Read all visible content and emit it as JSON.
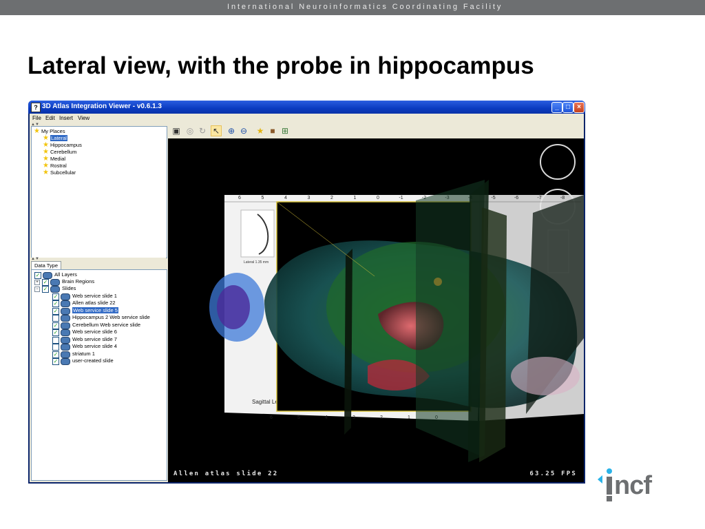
{
  "header": {
    "organization": "International Neuroinformatics Coordinating Facility"
  },
  "slide": {
    "title": "Lateral view, with the probe in hippocampus"
  },
  "window": {
    "app_icon": "?",
    "title": "3D Atlas Integration Viewer - v0.6.1.3",
    "controls": {
      "minimize": "_",
      "maximize": "□",
      "close": "×"
    }
  },
  "menu": {
    "items": [
      "File",
      "Edit",
      "Insert",
      "View"
    ]
  },
  "places": {
    "root": "My Places",
    "items": [
      "Lateral",
      "Hippocampus",
      "Cerebellum",
      "Medial",
      "Rostral",
      "Subcellular"
    ],
    "selected": "Lateral"
  },
  "layers": {
    "tab": "Data Type",
    "all_layers": "All Layers",
    "groups": {
      "brain_regions": "Brain Regions",
      "slides": "Slides"
    },
    "slides": [
      {
        "label": "Web service slide 1",
        "checked": true
      },
      {
        "label": "Allen atlas slide 22",
        "checked": true
      },
      {
        "label": "Web service slide 5",
        "checked": true,
        "selected": true
      },
      {
        "label": "Hippocampus 2 Web service slide",
        "checked": false
      },
      {
        "label": "Cerebellum Web service slide",
        "checked": true
      },
      {
        "label": "Web service slide 6",
        "checked": true
      },
      {
        "label": "Web service slide 7",
        "checked": false
      },
      {
        "label": "Web service slide 4",
        "checked": false
      },
      {
        "label": "striatum 1",
        "checked": true
      },
      {
        "label": "user-created slide",
        "checked": true
      }
    ]
  },
  "toolbar": {
    "icons": [
      "layout-icon",
      "disc-icon",
      "rotate-icon",
      "pointer-icon",
      "zoom-in-icon",
      "zoom-out-icon",
      "add-place-icon",
      "package-icon",
      "screenshot-icon"
    ]
  },
  "viewport": {
    "status_left": "Allen atlas slide 22",
    "status_right": "63.25 FPS",
    "ruler_labels": [
      "6",
      "5",
      "4",
      "3",
      "2",
      "1",
      "0",
      "-1",
      "-2",
      "-3",
      "-4",
      "-5",
      "-6",
      "-7",
      "-8"
    ],
    "bottom_ruler": [
      "6",
      "5",
      "4",
      "3",
      "2",
      "1",
      "0"
    ],
    "slice_caption": "Lateral 1.35 mm",
    "level_label": "Sagittal Level"
  },
  "footer": {
    "logo_text": "incf"
  },
  "colors": {
    "accent": "#2bb3e8",
    "window_title": "#0a3bc0"
  }
}
